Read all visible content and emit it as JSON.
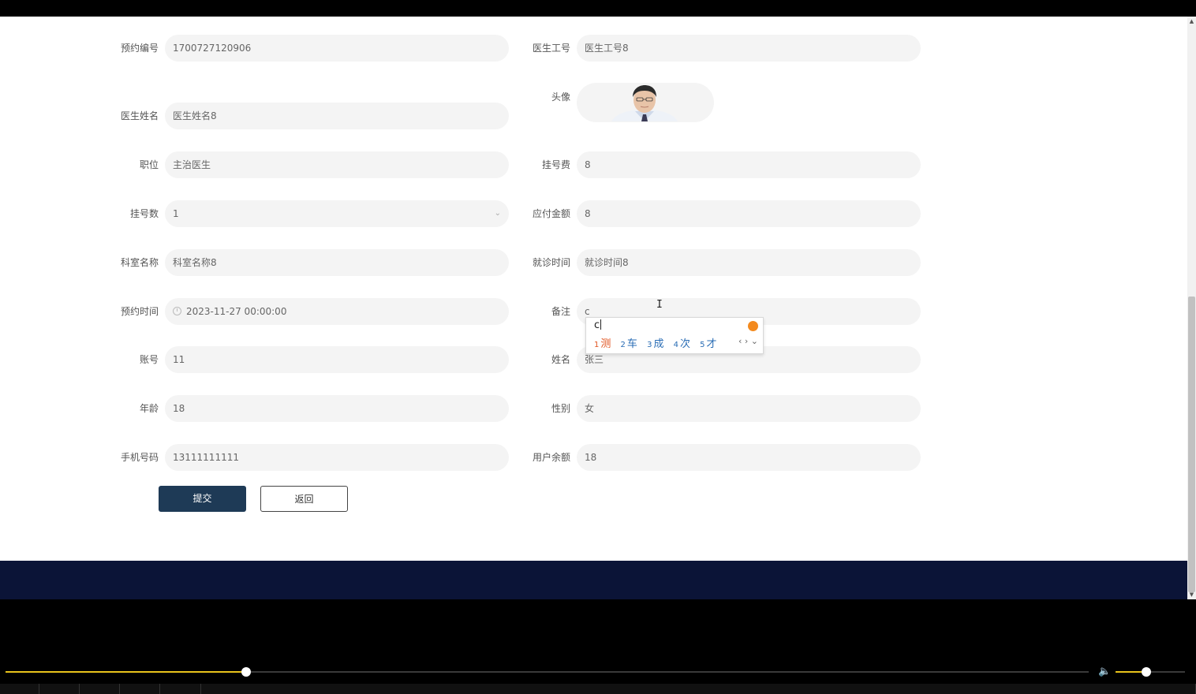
{
  "form": {
    "rows": [
      {
        "left": {
          "label": "预约编号",
          "value": "1700727120906"
        },
        "right": {
          "label": "医生工号",
          "value": "医生工号8"
        }
      },
      {
        "left": {
          "label": "医生姓名",
          "value": "医生姓名8"
        },
        "right": {
          "label": "头像",
          "value": ""
        }
      },
      {
        "left": {
          "label": "职位",
          "value": "主治医生"
        },
        "right": {
          "label": "挂号费",
          "value": "8"
        }
      },
      {
        "left": {
          "label": "挂号数",
          "value": "1"
        },
        "right": {
          "label": "应付金额",
          "value": "8"
        }
      },
      {
        "left": {
          "label": "科室名称",
          "value": "科室名称8"
        },
        "right": {
          "label": "就诊时间",
          "value": "就诊时间8"
        }
      },
      {
        "left": {
          "label": "预约时间",
          "value": "2023-11-27 00:00:00"
        },
        "right": {
          "label": "备注",
          "value": "c"
        }
      },
      {
        "left": {
          "label": "账号",
          "value": "11"
        },
        "right": {
          "label": "姓名",
          "value": "张三"
        }
      },
      {
        "left": {
          "label": "年龄",
          "value": "18"
        },
        "right": {
          "label": "性别",
          "value": "女"
        }
      },
      {
        "left": {
          "label": "手机号码",
          "value": "13111111111"
        },
        "right": {
          "label": "用户余额",
          "value": "18"
        }
      }
    ],
    "submit_label": "提交",
    "back_label": "返回"
  },
  "ime": {
    "composition": "c",
    "candidates": [
      {
        "index": "1",
        "text": "测"
      },
      {
        "index": "2",
        "text": "车"
      },
      {
        "index": "3",
        "text": "成"
      },
      {
        "index": "4",
        "text": "次"
      },
      {
        "index": "5",
        "text": "才"
      }
    ],
    "nav": "‹ › ⌄"
  },
  "player": {
    "progress": 0.222,
    "volume": 0.44,
    "accent_color": "#e8c31b"
  },
  "colors": {
    "footer": "#0b1437",
    "submit_button": "#1e3a56",
    "field_bg": "#f4f4f4"
  }
}
